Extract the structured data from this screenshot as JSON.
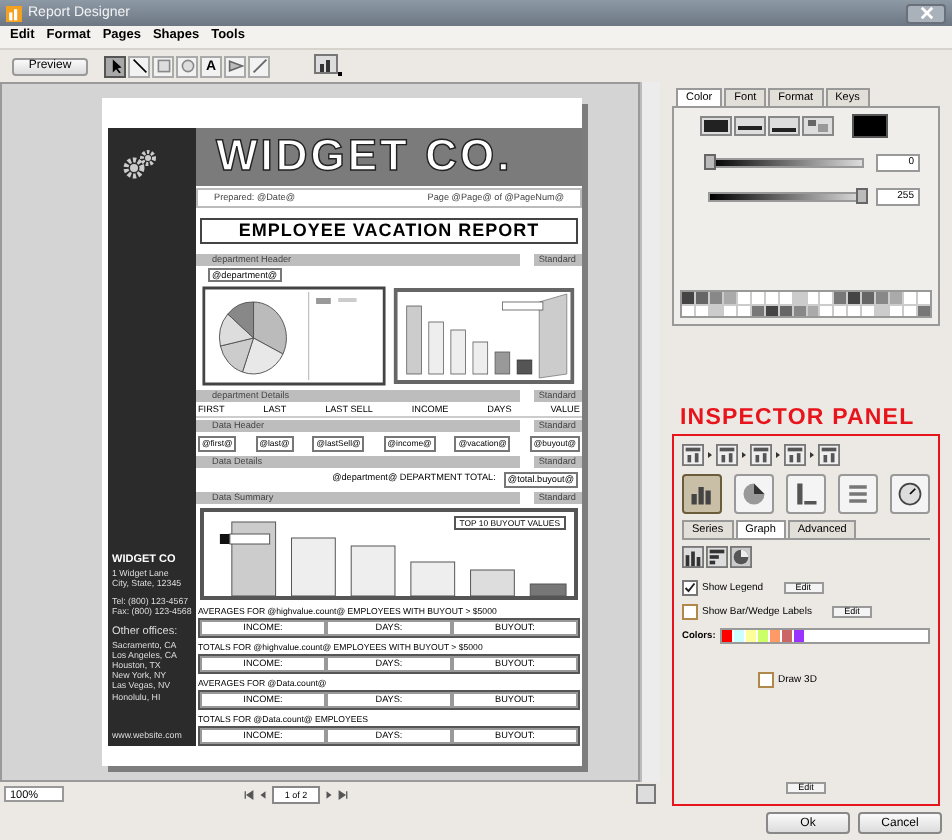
{
  "window": {
    "title": "Report Designer"
  },
  "menu": [
    "Edit",
    "Format",
    "Pages",
    "Shapes",
    "Tools"
  ],
  "toolbar": {
    "preview": "Preview",
    "tools": [
      {
        "kind": "pointer",
        "selected": true
      },
      {
        "kind": "line",
        "selected": false
      },
      {
        "kind": "rect",
        "selected": false
      },
      {
        "kind": "ellipse",
        "selected": false
      },
      {
        "kind": "text",
        "label": "A",
        "selected": false
      },
      {
        "kind": "image",
        "selected": false
      },
      {
        "kind": "pen",
        "selected": false
      }
    ]
  },
  "page": {
    "sidebar": {
      "company": "WIDGET CO",
      "address": [
        "1 Widget Lane",
        "City, State, 12345"
      ],
      "contact": [
        "Tel: (800) 123-4567",
        "Fax: (800) 123-4568"
      ],
      "offices_title": "Other offices:",
      "offices": [
        "Sacramento, CA",
        "Los Angeles, CA",
        "Houston, TX",
        "New York, NY",
        "Las Vegas, NV",
        "Honolulu, HI"
      ],
      "website": "www.website.com"
    },
    "banner": "WIDGET CO.",
    "prepared": "Prepared: @Date@",
    "page_of": "Page @Page@ of @PageNum@",
    "title": "EMPLOYEE VACATION REPORT",
    "rows": [
      {
        "kind": "band",
        "label": "department Header",
        "style": "Standard"
      },
      {
        "kind": "field",
        "text": "@department@"
      },
      {
        "kind": "charts"
      },
      {
        "kind": "band",
        "label": "department Details",
        "style": "Standard"
      },
      {
        "kind": "columns",
        "cells": [
          "FIRST",
          "LAST",
          "LAST SELL",
          "INCOME",
          "DAYS",
          "VALUE"
        ]
      },
      {
        "kind": "band",
        "label": "Data Header",
        "style": "Standard"
      },
      {
        "kind": "fields",
        "cells": [
          "@first@",
          "@last@",
          "@lastSell@",
          "@income@",
          "@vacation@",
          "@buyout@"
        ]
      },
      {
        "kind": "band",
        "label": "Data Details",
        "style": "Standard"
      },
      {
        "kind": "total",
        "cells": [
          "@department@ DEPARTMENT TOTAL:",
          "@total.buyout@"
        ]
      },
      {
        "kind": "band",
        "label": "Data Summary",
        "style": "Standard"
      },
      {
        "kind": "summary_chart",
        "label": "TOP 10 BUYOUT VALUES"
      },
      {
        "kind": "caption",
        "text": "AVERAGES FOR @highvalue.count@ EMPLOYEES WITH BUYOUT > $5000"
      },
      {
        "kind": "boxes",
        "cells": [
          "INCOME:",
          "DAYS:",
          "BUYOUT:"
        ]
      },
      {
        "kind": "caption",
        "text": "TOTALS FOR @highvalue.count@ EMPLOYEES WITH BUYOUT > $5000"
      },
      {
        "kind": "boxes",
        "cells": [
          "INCOME:",
          "DAYS:",
          "BUYOUT:"
        ]
      },
      {
        "kind": "caption",
        "text": "AVERAGES FOR @Data.count@"
      },
      {
        "kind": "boxes",
        "cells": [
          "INCOME:",
          "DAYS:",
          "BUYOUT:"
        ]
      },
      {
        "kind": "caption",
        "text": "TOTALS FOR @Data.count@ EMPLOYEES"
      },
      {
        "kind": "boxes",
        "cells": [
          "INCOME:",
          "DAYS:",
          "BUYOUT:"
        ]
      }
    ]
  },
  "zoom": "100%",
  "pager": "1 of 2",
  "style_panel": {
    "tabs": [
      {
        "label": "Color",
        "selected": true
      },
      {
        "label": "Font",
        "selected": false
      },
      {
        "label": "Format",
        "selected": false
      },
      {
        "label": "Keys",
        "selected": false
      }
    ],
    "sliders": [
      {
        "level": 0,
        "reading": "0"
      },
      {
        "level": 1,
        "reading": "255"
      }
    ]
  },
  "inspector": {
    "heading": "INSPECTOR PANEL",
    "chart_types": [
      {
        "kind": "bar",
        "selected": true
      },
      {
        "kind": "pie",
        "selected": false
      },
      {
        "kind": "axis",
        "selected": false
      },
      {
        "kind": "list",
        "selected": false
      },
      {
        "kind": "dial",
        "selected": false
      }
    ],
    "tabs": [
      {
        "label": "Series",
        "selected": false
      },
      {
        "label": "Graph",
        "selected": true
      },
      {
        "label": "Advanced",
        "selected": false
      }
    ],
    "options": [
      {
        "kind": "checkbox",
        "label": "Show Legend",
        "checked": true,
        "button": "Edit"
      },
      {
        "kind": "checkbox",
        "label": "Show Bar/Wedge Labels",
        "checked": false,
        "button": "Edit"
      },
      {
        "kind": "colors",
        "label": "Colors:",
        "colors": [
          {
            "color": "#ff0000"
          },
          {
            "color": "#ccffff"
          },
          {
            "color": "#ffff99"
          },
          {
            "color": "#ccff66"
          },
          {
            "color": "#ff9966"
          },
          {
            "color": "#cc6666"
          },
          {
            "color": "#9933ff"
          }
        ]
      },
      {
        "kind": "checkbox",
        "label": "Draw 3D",
        "checked": false
      }
    ],
    "edit": "Edit"
  },
  "buttons": [
    "Ok",
    "Cancel"
  ]
}
